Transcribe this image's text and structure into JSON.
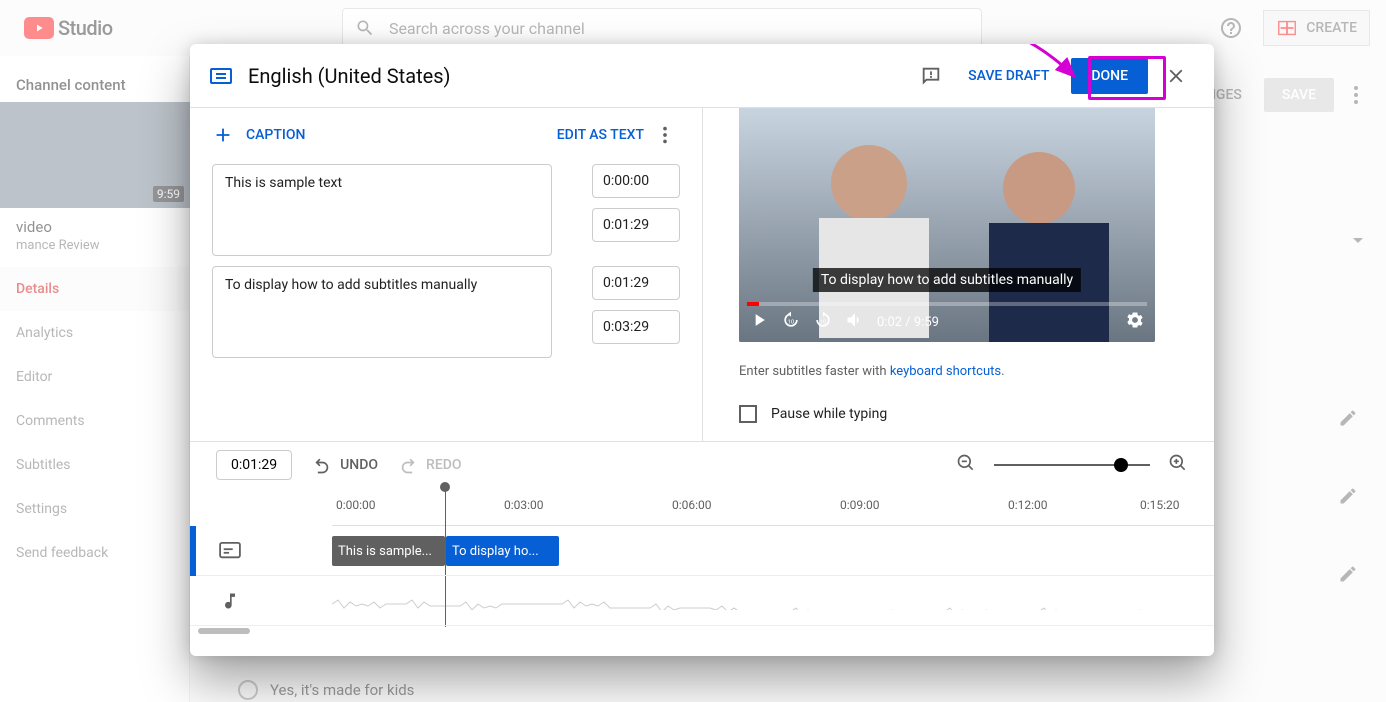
{
  "header": {
    "logo_text": "Studio",
    "search_placeholder": "Search across your channel",
    "create_label": "CREATE"
  },
  "sidebar": {
    "title": "Channel content",
    "video_title": "video",
    "video_subtitle": "mance Review",
    "video_duration": "9:59",
    "items": [
      {
        "label": "Details",
        "active": true
      },
      {
        "label": "Analytics"
      },
      {
        "label": "Editor"
      },
      {
        "label": "Comments"
      },
      {
        "label": "Subtitles"
      },
      {
        "label": "Settings"
      },
      {
        "label": "Send feedback"
      }
    ]
  },
  "bg_actions": {
    "changes_label": "NGES",
    "save_label": "SAVE"
  },
  "bg_kids_label": "Yes, it's made for kids",
  "modal": {
    "title": "English (United States)",
    "save_draft": "SAVE DRAFT",
    "done": "DONE",
    "toolbar": {
      "add_caption": "CAPTION",
      "edit_as_text": "EDIT AS TEXT"
    },
    "captions": [
      {
        "text": "This is sample text",
        "start": "0:00:00",
        "end": "0:01:29"
      },
      {
        "text": "To display how to add subtitles manually",
        "start": "0:01:29",
        "end": "0:03:29"
      }
    ],
    "preview": {
      "caption_overlay": "To display how to add subtitles manually",
      "current_time": "0:02",
      "duration": "9:59",
      "shortcuts_prefix": "Enter subtitles faster with ",
      "shortcuts_link": "keyboard shortcuts",
      "pause_label": "Pause while typing"
    },
    "timeline": {
      "current": "0:01:29",
      "undo": "UNDO",
      "redo": "REDO",
      "ticks": [
        "0:00:00",
        "0:03:00",
        "0:06:00",
        "0:09:00",
        "0:12:00",
        "0:15:20"
      ],
      "clip1": "This is sample...",
      "clip2": "To display ho..."
    }
  }
}
